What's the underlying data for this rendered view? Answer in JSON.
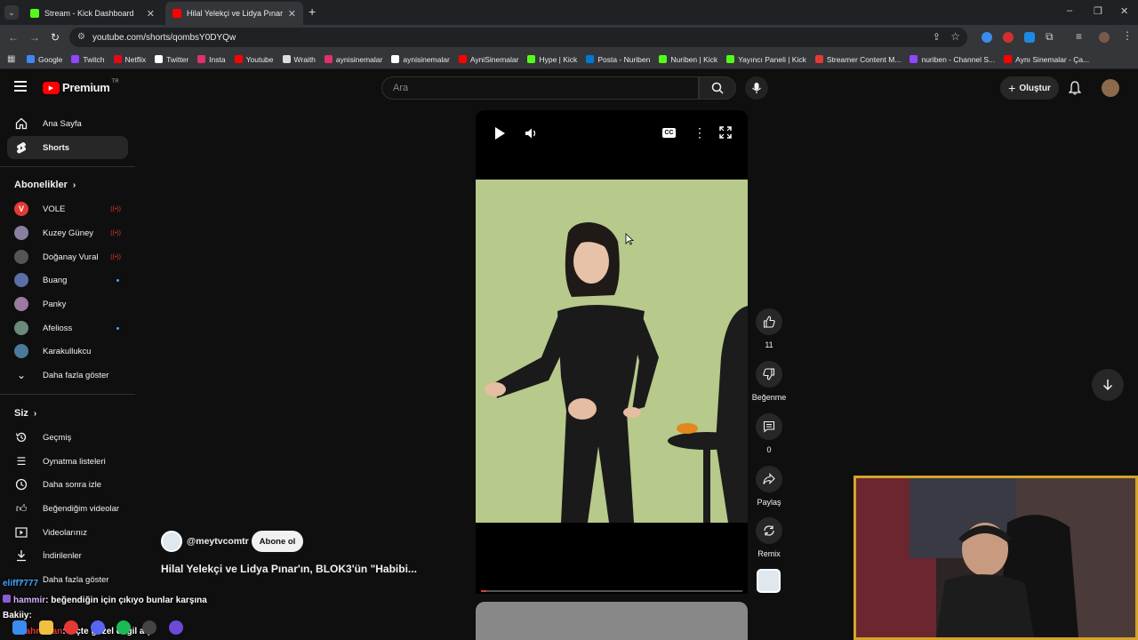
{
  "browser": {
    "tabs": [
      {
        "title": "Stream - Kick Dashboard",
        "active": false
      },
      {
        "title": "Hilal Yelekçi ve Lidya Pınar'ın, Bl",
        "active": true
      }
    ],
    "url": "youtube.com/shorts/qombsY0DYQw",
    "bookmarks": [
      {
        "label": "Google",
        "color": "#4285f4"
      },
      {
        "label": "Twitch",
        "color": "#9146ff"
      },
      {
        "label": "Netflix",
        "color": "#e50914"
      },
      {
        "label": "Twitter",
        "color": "#ffffff"
      },
      {
        "label": "Insta",
        "color": "#e1306c"
      },
      {
        "label": "Youtube",
        "color": "#ff0000"
      },
      {
        "label": "Wraith",
        "color": "#dddddd"
      },
      {
        "label": "aynisinemalar",
        "color": "#e1306c"
      },
      {
        "label": "aynisinemalar",
        "color": "#ffffff"
      },
      {
        "label": "AyniSinemalar",
        "color": "#ff0000"
      },
      {
        "label": "Hype | Kick",
        "color": "#53fc18"
      },
      {
        "label": "Posta - Nuriben",
        "color": "#0078d4"
      },
      {
        "label": "Nuriben | Kick",
        "color": "#53fc18"
      },
      {
        "label": "Yayıncı Paneli | Kick",
        "color": "#53fc18"
      },
      {
        "label": "Streamer Content M...",
        "color": "#e53935"
      },
      {
        "label": "nuriben - Channel S...",
        "color": "#9146ff"
      },
      {
        "label": "Aynı Sinemalar - Ça...",
        "color": "#ff0000"
      }
    ]
  },
  "youtube": {
    "logo": "Premium",
    "logo_badge": "TR",
    "search_placeholder": "Ara",
    "create_label": "Oluştur"
  },
  "sidebar": {
    "main": [
      {
        "label": "Ana Sayfa",
        "icon": "home-icon"
      },
      {
        "label": "Shorts",
        "icon": "shorts-icon",
        "active": true
      }
    ],
    "subs_heading": "Abonelikler",
    "subs": [
      {
        "label": "VOLE",
        "color": "#e53935",
        "status": "live"
      },
      {
        "label": "Kuzey Güney",
        "color": "#8a7fa0",
        "status": "live"
      },
      {
        "label": "Doğanay Vural",
        "color": "#555555",
        "status": "live"
      },
      {
        "label": "Buang",
        "color": "#5b6ea8",
        "status": "new"
      },
      {
        "label": "Panky",
        "color": "#9a7aa0",
        "status": ""
      },
      {
        "label": "Afelioss",
        "color": "#6a8a7a",
        "status": "new"
      },
      {
        "label": "Karakullukcu",
        "color": "#4a7a9a",
        "status": ""
      },
      {
        "label": "Daha fazla göster",
        "color": "",
        "status": ""
      }
    ],
    "you_heading": "Siz",
    "you": [
      {
        "label": "Geçmiş",
        "icon": "history-icon"
      },
      {
        "label": "Oynatma listeleri",
        "icon": "playlists-icon"
      },
      {
        "label": "Daha sonra izle",
        "icon": "watch-later-icon"
      },
      {
        "label": "Beğendiğim videolar",
        "icon": "liked-icon"
      },
      {
        "label": "Videolarınız",
        "icon": "your-videos-icon"
      },
      {
        "label": "İndirilenler",
        "icon": "downloads-icon"
      },
      {
        "label": "Daha fazla göster",
        "icon": "chevron-down-icon"
      }
    ]
  },
  "short": {
    "channel": "@meytvcomtr",
    "subscribe_label": "Abone ol",
    "title": "Hilal Yelekçi ve Lidya Pınar'ın, BLOK3'ün \"Habibi...",
    "progress": 0.02,
    "actions": [
      {
        "name": "like",
        "label": "11"
      },
      {
        "name": "dislike",
        "label": "Beğenme"
      },
      {
        "name": "comments",
        "label": "0"
      },
      {
        "name": "share",
        "label": "Paylaş"
      },
      {
        "name": "remix",
        "label": "Remix"
      }
    ]
  },
  "chat": [
    {
      "user": "eliff7777",
      "user_color": "#3ea6ff",
      "text": ""
    },
    {
      "user": "hammir",
      "user_color": "#d4b3ff",
      "text": ": beğendiğin için çıkıyo bunlar karşına"
    },
    {
      "user": "Bakiiy",
      "user_color": "#ffffff",
      "text": ":"
    },
    {
      "user": "kahraman",
      "user_color": "#e53935",
      "text": ": hiçte güzel değil aq"
    }
  ]
}
